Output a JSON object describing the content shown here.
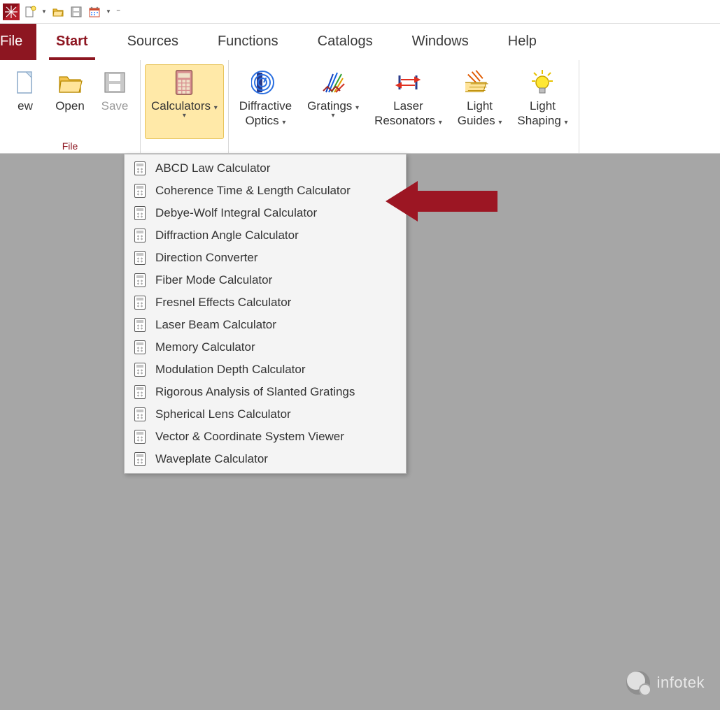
{
  "qat": {
    "items": [
      {
        "name": "app-logo",
        "kind": "logo"
      },
      {
        "name": "new-document",
        "kind": "new"
      },
      {
        "name": "dropdown-1",
        "kind": "caret"
      },
      {
        "name": "open-folder",
        "kind": "open"
      },
      {
        "name": "save-disk",
        "kind": "save"
      },
      {
        "name": "calendar",
        "kind": "calendar"
      },
      {
        "name": "dropdown-2",
        "kind": "caret"
      },
      {
        "name": "qat-customize",
        "kind": "customize"
      }
    ]
  },
  "tabs": [
    {
      "name": "file",
      "label": "File",
      "style": "file"
    },
    {
      "name": "start",
      "label": "Start",
      "active": true
    },
    {
      "name": "sources",
      "label": "Sources"
    },
    {
      "name": "functions",
      "label": "Functions"
    },
    {
      "name": "catalogs",
      "label": "Catalogs"
    },
    {
      "name": "windows",
      "label": "Windows"
    },
    {
      "name": "help",
      "label": "Help"
    }
  ],
  "ribbon": {
    "groups": [
      {
        "name": "file",
        "label": "File",
        "buttons": [
          {
            "name": "new",
            "label": "ew",
            "icon": "page",
            "disabled": false,
            "dropdown": false,
            "partial": true
          },
          {
            "name": "open",
            "label": "Open",
            "icon": "folder"
          },
          {
            "name": "save",
            "label": "Save",
            "icon": "floppy",
            "disabled": true
          }
        ]
      },
      {
        "name": "calculators-group",
        "label": "",
        "buttons": [
          {
            "name": "calculators",
            "label": "Calculators",
            "icon": "calculator",
            "dropdown": true,
            "active": true
          }
        ]
      },
      {
        "name": "tools",
        "label": "",
        "buttons": [
          {
            "name": "diffractive-optics",
            "label": "Diffractive\nOptics",
            "icon": "diffractive",
            "dropdown": true
          },
          {
            "name": "gratings",
            "label": "Gratings",
            "icon": "gratings",
            "dropdown": true
          },
          {
            "name": "laser-resonators",
            "label": "Laser\nResonators",
            "icon": "resonator",
            "dropdown": true
          },
          {
            "name": "light-guides",
            "label": "Light\nGuides",
            "icon": "guides",
            "dropdown": true
          },
          {
            "name": "light-shaping",
            "label": "Light\nShaping",
            "icon": "bulb",
            "dropdown": true
          }
        ]
      }
    ]
  },
  "calculators_menu": [
    "ABCD Law Calculator",
    "Coherence Time & Length Calculator",
    "Debye-Wolf Integral Calculator",
    "Diffraction Angle Calculator",
    "Direction Converter",
    "Fiber Mode Calculator",
    "Fresnel Effects Calculator",
    "Laser Beam Calculator",
    "Memory Calculator",
    "Modulation Depth Calculator",
    "Rigorous Analysis of Slanted Gratings",
    "Spherical Lens Calculator",
    "Vector & Coordinate System Viewer",
    "Waveplate Calculator"
  ],
  "arrow_target_index": 1,
  "watermark": {
    "label": "infotek"
  }
}
